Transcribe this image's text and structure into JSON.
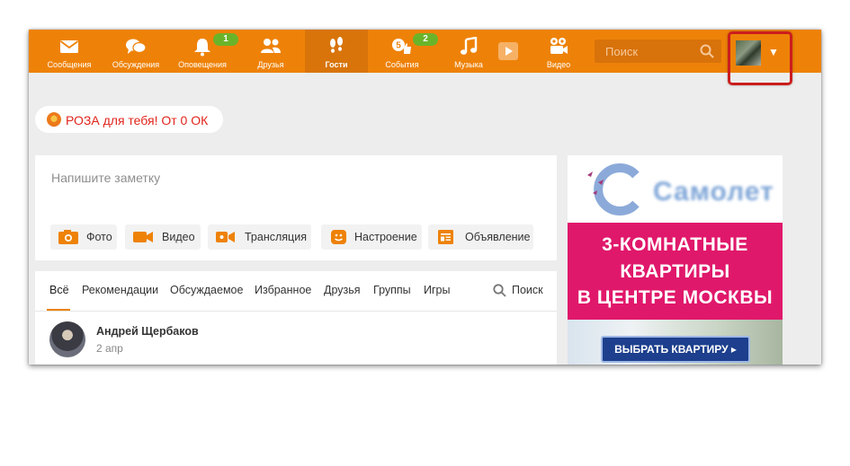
{
  "colors": {
    "brand_orange": "#ee8208",
    "badge_green": "#6ab42a",
    "promo_red": "#e0241b",
    "ad_pink": "#e0186b",
    "highlight_red": "#cc1d1d"
  },
  "topbar": {
    "nav": [
      {
        "label": "Сообщения",
        "icon": "envelope-icon"
      },
      {
        "label": "Обсуждения",
        "icon": "chat-bubbles-icon"
      },
      {
        "label": "Оповещения",
        "icon": "bell-icon",
        "badge": "1"
      },
      {
        "label": "Друзья",
        "icon": "people-icon"
      },
      {
        "label": "Гости",
        "icon": "footprints-icon",
        "active": true
      },
      {
        "label": "События",
        "icon": "thumbs-up-icon",
        "badge": "2",
        "sub_badge": "5"
      },
      {
        "label": "Музыка",
        "icon": "music-note-icon"
      },
      {
        "label": "Видео",
        "icon": "video-camera-icon"
      }
    ],
    "search": {
      "placeholder": "Поиск",
      "icon": "search-icon"
    },
    "profile": {
      "icon": "avatar-thumbnail",
      "caret": "▼"
    }
  },
  "promo": {
    "text": "РОЗА для тебя! От 0 ОК",
    "icon": "rose-icon"
  },
  "composer": {
    "placeholder": "Напишите заметку",
    "actions": [
      {
        "label": "Фото",
        "icon": "camera-icon"
      },
      {
        "label": "Видео",
        "icon": "video-icon"
      },
      {
        "label": "Трансляция",
        "icon": "broadcast-icon"
      },
      {
        "label": "Настроение",
        "icon": "smile-icon"
      },
      {
        "label": "Объявление",
        "icon": "announcement-icon"
      }
    ]
  },
  "feed": {
    "tabs": [
      "Всё",
      "Рекомендации",
      "Обсуждаемое",
      "Избранное",
      "Друзья",
      "Группы",
      "Игры"
    ],
    "search_label": "Поиск",
    "post": {
      "author": "Андрей Щербаков",
      "date": "2 апр"
    }
  },
  "ad": {
    "brand": "Самолет",
    "lines": [
      "3-КОМНАТНЫЕ",
      "КВАРТИРЫ",
      "В ЦЕНТРЕ МОСКВЫ"
    ],
    "cta": "ВЫБРАТЬ КВАРТИРУ ▸"
  }
}
